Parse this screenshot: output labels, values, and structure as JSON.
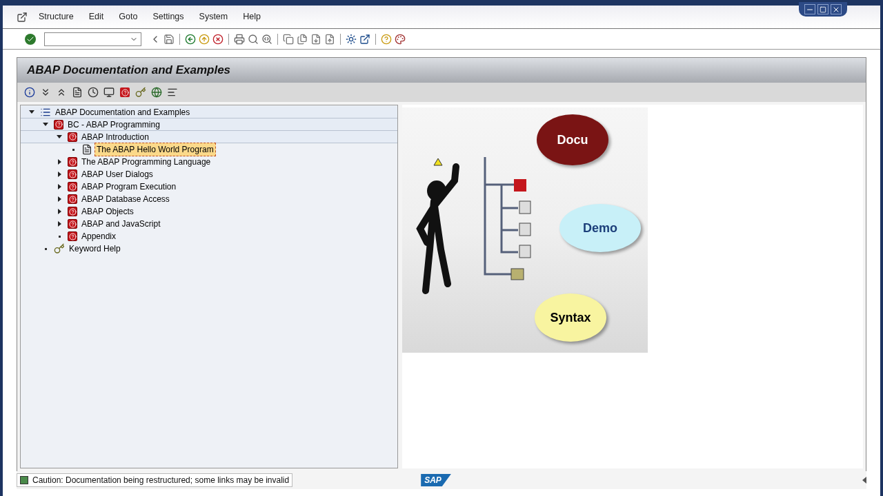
{
  "menu": {
    "items": [
      "Structure",
      "Edit",
      "Goto",
      "Settings",
      "System",
      "Help"
    ]
  },
  "screen_title": "ABAP Documentation and Examples",
  "tree": [
    {
      "label": "ABAP Documentation and Examples",
      "kind": "structure",
      "expanded": true,
      "selected": false,
      "children": [
        {
          "label": "BC - ABAP Programming",
          "kind": "book",
          "expanded": true,
          "selected": false,
          "children": [
            {
              "label": "ABAP Introduction",
              "kind": "book",
              "expanded": true,
              "selected": false,
              "children": [
                {
                  "label": "The ABAP Hello World Program",
                  "kind": "document",
                  "selected": true
                }
              ]
            },
            {
              "label": "The ABAP Programming Language",
              "kind": "book",
              "expanded": false,
              "selected": false
            },
            {
              "label": "ABAP User Dialogs",
              "kind": "book",
              "expanded": false,
              "selected": false
            },
            {
              "label": "ABAP Program Execution",
              "kind": "book",
              "expanded": false,
              "selected": false
            },
            {
              "label": "ABAP Database Access",
              "kind": "book",
              "expanded": false,
              "selected": false
            },
            {
              "label": "ABAP Objects",
              "kind": "book",
              "expanded": false,
              "selected": false
            },
            {
              "label": "ABAP and JavaScript",
              "kind": "book",
              "expanded": false,
              "selected": false
            },
            {
              "label": "Appendix",
              "kind": "book",
              "selected": false
            }
          ]
        },
        {
          "label": "Keyword Help",
          "kind": "keyword",
          "selected": false
        }
      ]
    }
  ],
  "illustration": {
    "bubbles": [
      {
        "text": "Docu",
        "color": "#7a1414"
      },
      {
        "text": "Demo",
        "color": "#c8f0f8"
      },
      {
        "text": "Syntax",
        "color": "#f8f4a0"
      }
    ]
  },
  "status_bar": {
    "message": "Caution: Documentation being restructured; some links may be invalid",
    "logo": "SAP"
  }
}
